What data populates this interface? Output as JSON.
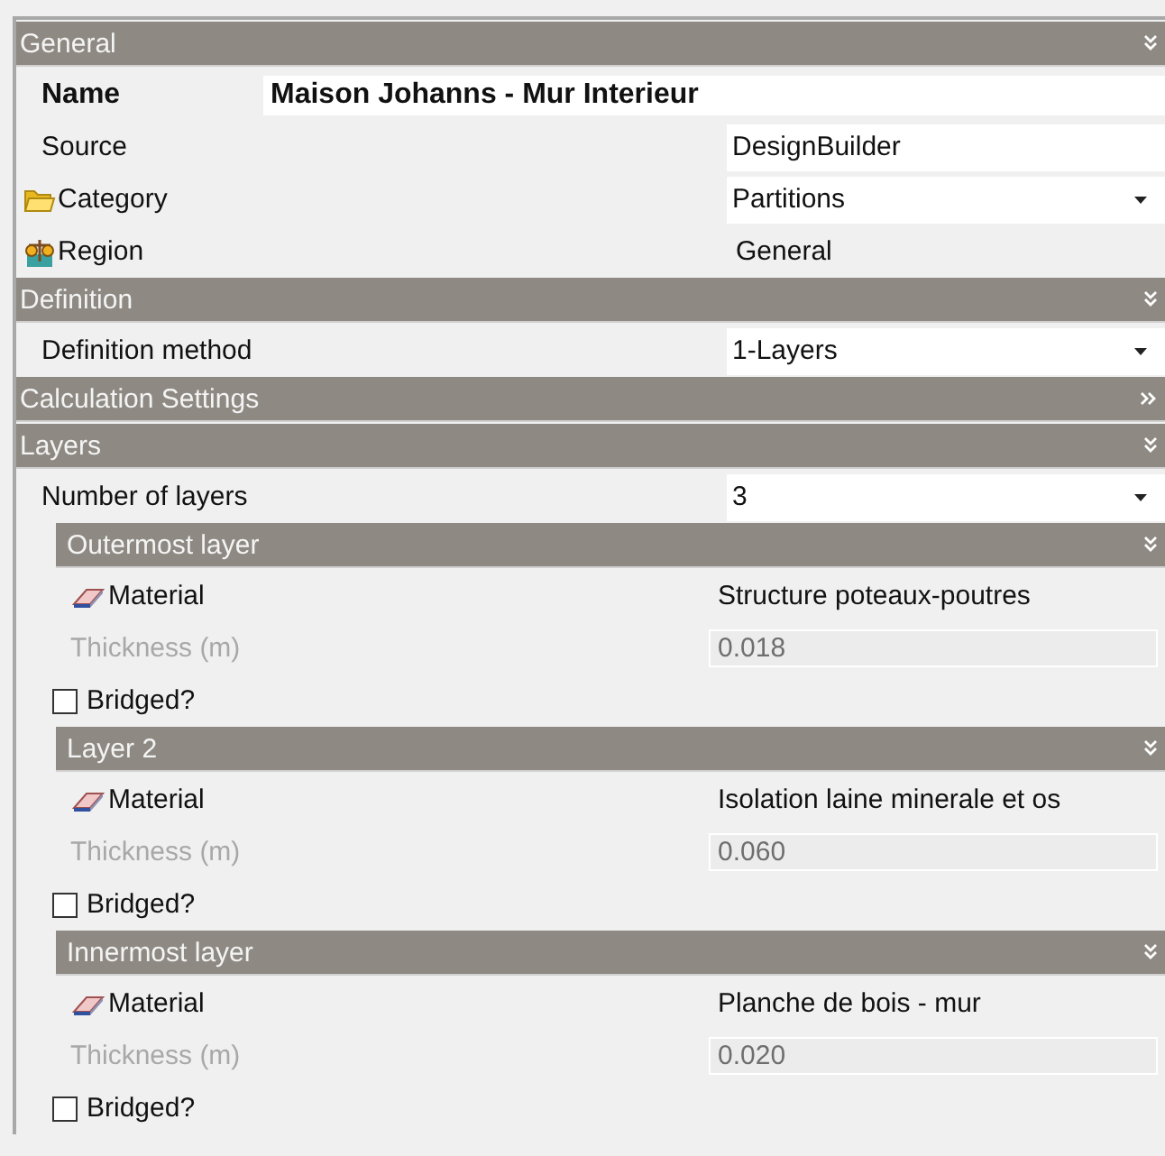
{
  "sections": [
    {
      "title": "General",
      "expanded": true,
      "rows": [
        {
          "kind": "name",
          "label": "Name",
          "value": "Maison Johanns - Mur Interieur"
        },
        {
          "kind": "text_field",
          "label": "Source",
          "value": "DesignBuilder"
        },
        {
          "kind": "category_dropdown",
          "label": "Category",
          "value": "Partitions"
        },
        {
          "kind": "region",
          "label": "Region",
          "value": "General"
        }
      ]
    },
    {
      "title": "Definition",
      "expanded": true,
      "rows": [
        {
          "kind": "dropdown",
          "label": "Definition method",
          "value": "1-Layers"
        }
      ]
    },
    {
      "title": "Calculation Settings",
      "expanded": false
    },
    {
      "title": "Layers",
      "expanded": true,
      "rows": [
        {
          "kind": "dropdown",
          "label": "Number of layers",
          "value": "3"
        }
      ],
      "subsections": [
        {
          "title": "Outermost layer",
          "expanded": true,
          "rows": [
            {
              "kind": "material",
              "label": "Material",
              "value": "Structure poteaux-poutres"
            },
            {
              "kind": "number_field",
              "label": "Thickness (m)",
              "value": "0.018",
              "disabled": true
            },
            {
              "kind": "checkbox",
              "label": "Bridged?",
              "checked": false
            }
          ]
        },
        {
          "title": "Layer 2",
          "expanded": true,
          "rows": [
            {
              "kind": "material",
              "label": "Material",
              "value": "Isolation laine minerale et os"
            },
            {
              "kind": "number_field",
              "label": "Thickness (m)",
              "value": "0.060",
              "disabled": true
            },
            {
              "kind": "checkbox",
              "label": "Bridged?",
              "checked": false
            }
          ]
        },
        {
          "title": "Innermost layer",
          "expanded": true,
          "rows": [
            {
              "kind": "material",
              "label": "Material",
              "value": "Planche de bois - mur"
            },
            {
              "kind": "number_field",
              "label": "Thickness (m)",
              "value": "0.020",
              "disabled": true
            },
            {
              "kind": "checkbox",
              "label": "Bridged?",
              "checked": false
            }
          ]
        }
      ]
    }
  ]
}
